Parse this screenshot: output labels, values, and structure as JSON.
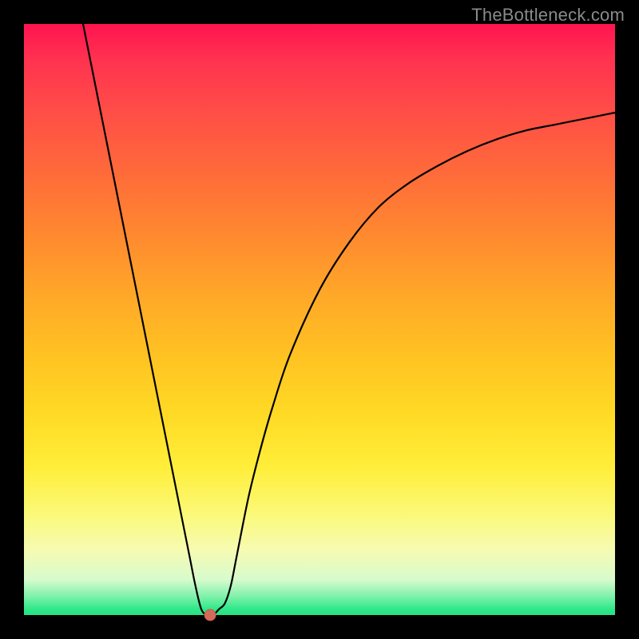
{
  "watermark": "TheBottleneck.com",
  "chart_data": {
    "type": "line",
    "title": "",
    "xlabel": "",
    "ylabel": "",
    "xlim": [
      0,
      100
    ],
    "ylim": [
      0,
      100
    ],
    "grid": false,
    "series": [
      {
        "name": "bottleneck-curve",
        "color": "#000000",
        "x": [
          10,
          12,
          14,
          16,
          18,
          20,
          22,
          24,
          26,
          28,
          29,
          30,
          31,
          32,
          33,
          34,
          35,
          36,
          38,
          40,
          42,
          45,
          50,
          55,
          60,
          65,
          70,
          75,
          80,
          85,
          90,
          95,
          100
        ],
        "y": [
          100,
          90,
          80,
          70,
          60,
          50,
          40,
          30,
          20,
          10,
          5,
          1,
          0,
          0,
          1,
          2,
          5,
          10,
          20,
          28,
          35,
          44,
          55,
          63,
          69,
          73,
          76,
          78.5,
          80.5,
          82,
          83,
          84,
          85
        ]
      }
    ],
    "markers": [
      {
        "name": "optimal-point",
        "x": 31.5,
        "y": 0,
        "color": "#d66a5a",
        "radius_px": 7
      }
    ]
  }
}
